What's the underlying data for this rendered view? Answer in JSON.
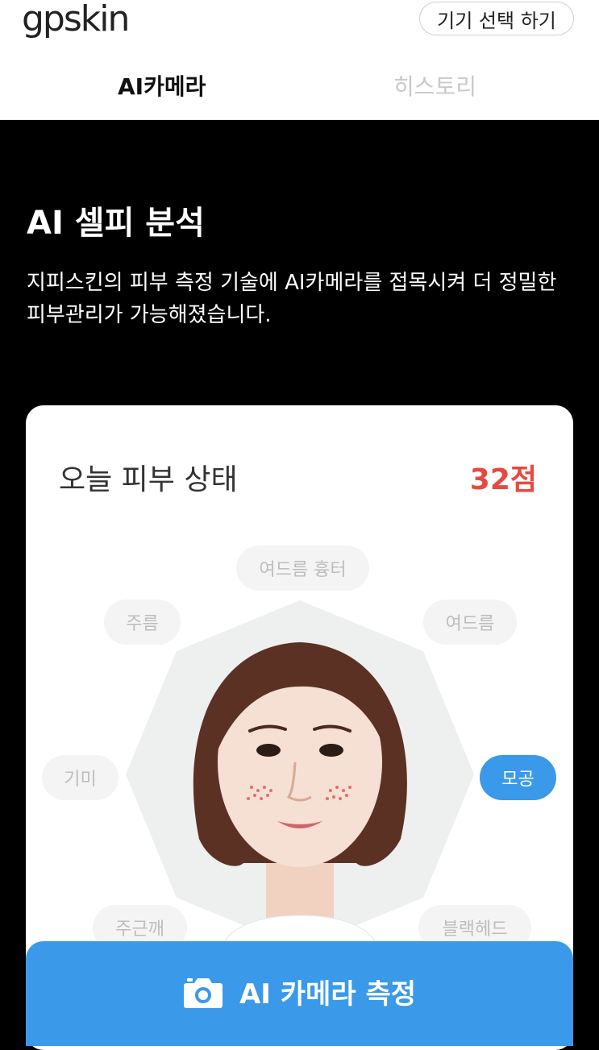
{
  "header": {
    "logo": "gpskin",
    "device_button": "기기 선택 하기",
    "tabs": [
      {
        "label": "AI카메라",
        "active": true
      },
      {
        "label": "히스토리",
        "active": false
      }
    ]
  },
  "hero": {
    "title": "AI 셀피 분석",
    "description": "지피스킨의 피부 측정 기술에 AI카메라를 접목시켜 더 정밀한 피부관리가 가능해졌습니다."
  },
  "card": {
    "title": "오늘 피부 상태",
    "score": "32점",
    "score_color": "#e8493f",
    "chips": [
      {
        "label": "여드름 흉터",
        "active": false
      },
      {
        "label": "주름",
        "active": false
      },
      {
        "label": "여드름",
        "active": false
      },
      {
        "label": "기미",
        "active": false
      },
      {
        "label": "모공",
        "active": true
      },
      {
        "label": "주근깨",
        "active": false
      },
      {
        "label": "블랙헤드",
        "active": false
      }
    ]
  },
  "measure_button": {
    "label": "AI 카메라 측정",
    "icon": "camera-icon"
  },
  "colors": {
    "accent": "#3a99e8",
    "score": "#e8493f",
    "background": "#000000"
  }
}
